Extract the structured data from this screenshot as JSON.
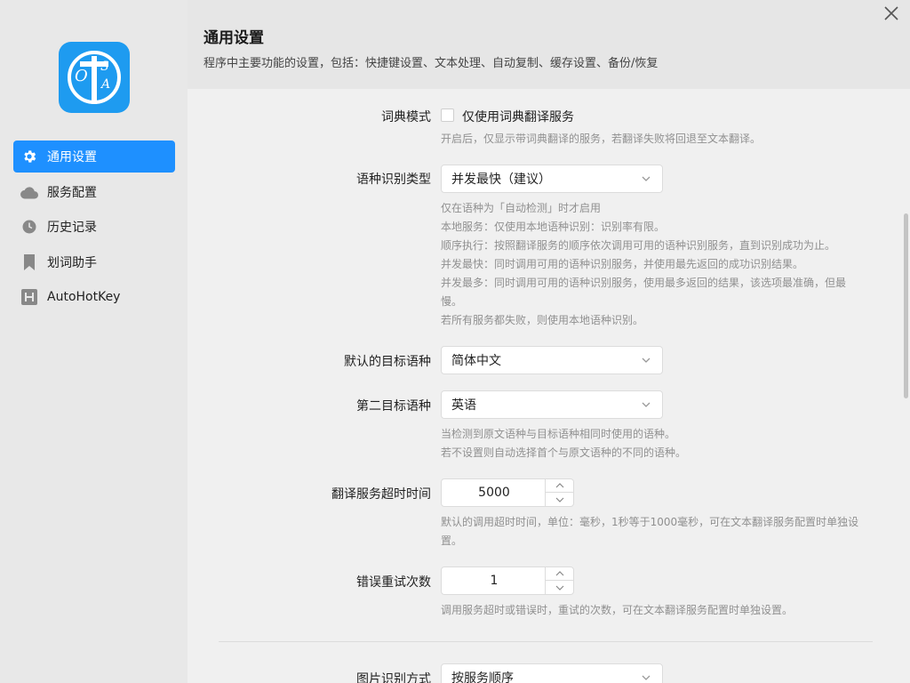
{
  "sidebar": {
    "logo_letters": [
      "O",
      "T",
      "S",
      "A"
    ],
    "items": [
      {
        "label": "通用设置",
        "icon": "gear-icon",
        "active": true
      },
      {
        "label": "服务配置",
        "icon": "cloud-icon",
        "active": false
      },
      {
        "label": "历史记录",
        "icon": "clock-icon",
        "active": false
      },
      {
        "label": "划词助手",
        "icon": "bookmark-icon",
        "active": false
      },
      {
        "label": "AutoHotKey",
        "icon": "h-icon",
        "active": false
      }
    ]
  },
  "header": {
    "title": "通用设置",
    "description": "程序中主要功能的设置，包括：快捷键设置、文本处理、自动复制、缓存设置、备份/恢复"
  },
  "settings": {
    "dict_mode": {
      "label": "词典模式",
      "checkbox_label": "仅使用词典翻译服务",
      "checked": false,
      "hint": "开启后，仅显示带词典翻译的服务，若翻译失败将回退至文本翻译。"
    },
    "lang_detect": {
      "label": "语种识别类型",
      "value": "并发最快（建议）",
      "hints": [
        "仅在语种为「自动检测」时才启用",
        "本地服务：仅使用本地语种识别：识别率有限。",
        "顺序执行：按照翻译服务的顺序依次调用可用的语种识别服务，直到识别成功为止。",
        "并发最快：同时调用可用的语种识别服务，并使用最先返回的成功识别结果。",
        "并发最多：同时调用可用的语种识别服务，使用最多返回的结果，该选项最准确，但最",
        "慢。",
        "若所有服务都失败，则使用本地语种识别。"
      ]
    },
    "default_target": {
      "label": "默认的目标语种",
      "value": "简体中文"
    },
    "second_target": {
      "label": "第二目标语种",
      "value": "英语",
      "hints": [
        "当检测到原文语种与目标语种相同时使用的语种。",
        "若不设置则自动选择首个与原文语种的不同的语种。"
      ]
    },
    "timeout": {
      "label": "翻译服务超时时间",
      "value": "5000",
      "hints": [
        "默认的调用超时时间，单位：毫秒，1秒等于1000毫秒，可在文本翻译服务配置时单独设",
        "置。"
      ]
    },
    "retry": {
      "label": "错误重试次数",
      "value": "1",
      "hint": "调用服务超时或错误时，重试的次数，可在文本翻译服务配置时单独设置。"
    },
    "ocr_mode": {
      "label": "图片识别方式",
      "value": "按服务顺序"
    }
  }
}
